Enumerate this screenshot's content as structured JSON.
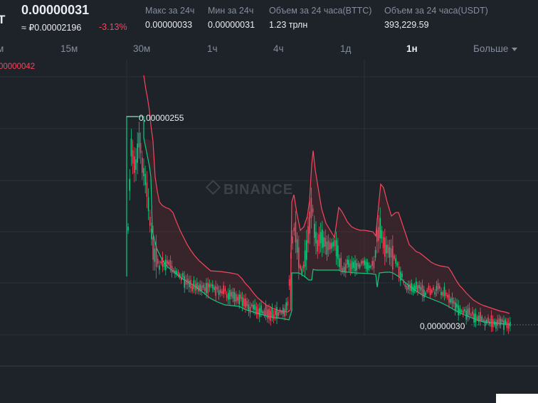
{
  "header": {
    "symbol_fragment": "T",
    "last_price": "0.00000031",
    "fiat_price": "≈ ₽0.00002196",
    "change_pct": "-3.13%",
    "stats": [
      {
        "label": "Макс за 24ч",
        "value": "0.00000033"
      },
      {
        "label": "Мин за 24ч",
        "value": "0.00000031"
      },
      {
        "label": "Объем за 24 часа(BTTC)",
        "value": "1.23 трлн"
      },
      {
        "label": "Объем за 24 часа(USDT)",
        "value": "393,229.59"
      }
    ]
  },
  "intervals": {
    "items": [
      "м",
      "15м",
      "30м",
      "1ч",
      "4ч",
      "1д",
      "1н"
    ],
    "active": "1н",
    "more_label": "Больше"
  },
  "chart": {
    "top_price_label": "00000042",
    "high_label": "0,00000255",
    "low_label": "0,00000030",
    "watermark": "BINANCE",
    "colors": {
      "up": "#0ecb81",
      "down": "#f6465d",
      "band_fill": "#6b2a35",
      "grid": "#2b3139",
      "background": "#1e2229"
    }
  },
  "chart_data": {
    "type": "candlestick",
    "series": [
      {
        "values": [
          2.55e-06,
          2.1e-06,
          1.7e-06,
          1.3e-06,
          1.1e-06,
          9e-07,
          8e-07,
          7e-07,
          6e-07,
          4.5e-07,
          4e-07,
          1.8e-06,
          1.1e-06,
          1.2e-06,
          1e-06,
          9e-07,
          8e-07,
          7e-07,
          7e-07,
          1.3e-06,
          9e-07,
          8e-07,
          7e-07,
          6e-07,
          5e-07,
          4e-07,
          3.5e-07,
          3e-07,
          3e-07
        ]
      }
    ],
    "annotations": [
      "0,00000255",
      "0,00000030"
    ]
  }
}
